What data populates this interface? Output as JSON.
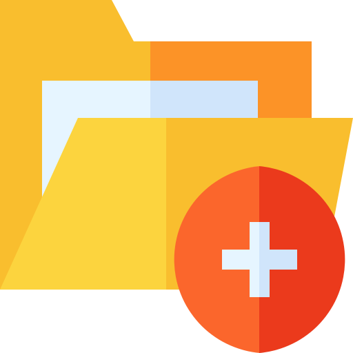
{
  "icon": {
    "name": "add-folder-icon",
    "parts": [
      "folder-icon",
      "plus-icon"
    ]
  },
  "colors": {
    "folder_back_left": "#F9BE2E",
    "folder_back_right": "#FC9327",
    "paper_left": "#E6F5FF",
    "paper_right": "#D0E5FB",
    "folder_front_left": "#FCD43E",
    "folder_front_right": "#F9BE2E",
    "badge_left": "#FB662C",
    "badge_right": "#EB3A1C",
    "plus_left": "#E6F5FF",
    "plus_right": "#D0E5FB"
  }
}
